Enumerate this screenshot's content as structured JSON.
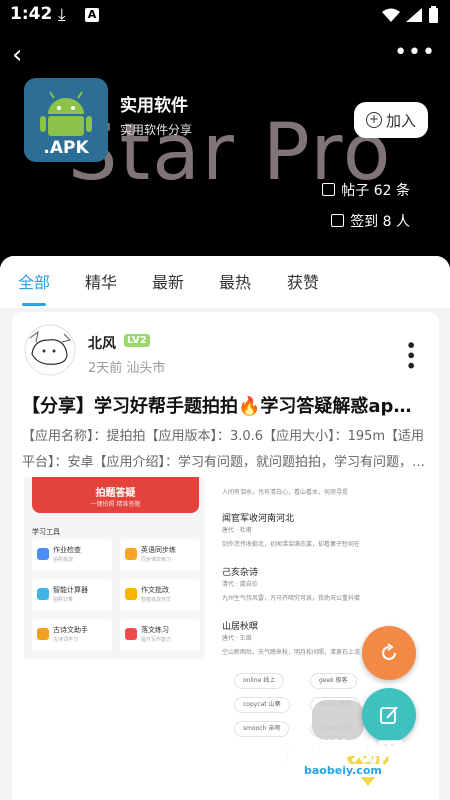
{
  "status": {
    "time": "1:42"
  },
  "group": {
    "name": "实用软件",
    "desc": "实用软件分享",
    "bg_title": "Star Pro",
    "icon_label": ".APK",
    "join_label": "加入",
    "posts_label": "帖子 62 条",
    "checkins_label": "签到 8 人"
  },
  "tabs": [
    {
      "label": "全部",
      "active": true
    },
    {
      "label": "精华"
    },
    {
      "label": "最新"
    },
    {
      "label": "最热"
    },
    {
      "label": "获赞"
    }
  ],
  "post": {
    "author": "北风",
    "level": "LV2",
    "meta": "2天前 汕头市",
    "title": "【分享】学习好帮手题拍拍🔥学习答疑解惑ap…",
    "body": "【应用名称】：提拍拍【应用版本】：3.0.6【应用大小】：195m【适用平台】：安卓【应用介绍】：学习有问题，就问题拍拍，学习有问题，…",
    "screenshot_left": {
      "banner_title": "拍题答疑",
      "banner_sub": "一键拍照  精准答题",
      "section": "学习工具",
      "tools": [
        {
          "name": "作业检查",
          "sub": "拍照批改",
          "color": "#4b8cf5"
        },
        {
          "name": "英语同步练",
          "sub": "同步课本练习",
          "color": "#f5a623"
        },
        {
          "name": "智能计算器",
          "sub": "拍照计算",
          "color": "#3fb6e8"
        },
        {
          "name": "作文批改",
          "sub": "智能批改作文",
          "color": "#f7b500"
        },
        {
          "name": "古诗文助手",
          "sub": "古诗词学习",
          "color": "#f0a020"
        },
        {
          "name": "落文练习",
          "sub": "提升写作能力",
          "color": "#ef4b4b"
        }
      ]
    },
    "screenshot_right": {
      "lines": [
        "人间有泪水，也有清白心，看山看水，何须寻觅",
        "闻官军收河南河北",
        "唐代 · 杜甫",
        "剑外忽传收蓟北，初闻涕泪满衣裳，却看妻子愁何在",
        "己亥杂诗",
        "清代 · 龚自珍",
        "九州生气恃风雷，万马齐喑究可哀，我劝天公重抖擞",
        "山居秋暝",
        "唐代 · 王维",
        "空山新雨后，天气晚来秋，明月松间照，清泉石上流"
      ],
      "chips": [
        "online 线上",
        "geek 极客",
        "copycat 山寨",
        "sexed 性别",
        "smooch 亲吻",
        "school 学校"
      ]
    }
  },
  "watermark": {
    "text": "宝贝游戏网",
    "url": "baobeiy.com"
  },
  "colors": {
    "accent": "#2aa3e3",
    "fab_refresh": "#f28a46",
    "fab_edit": "#3fc2bf"
  }
}
